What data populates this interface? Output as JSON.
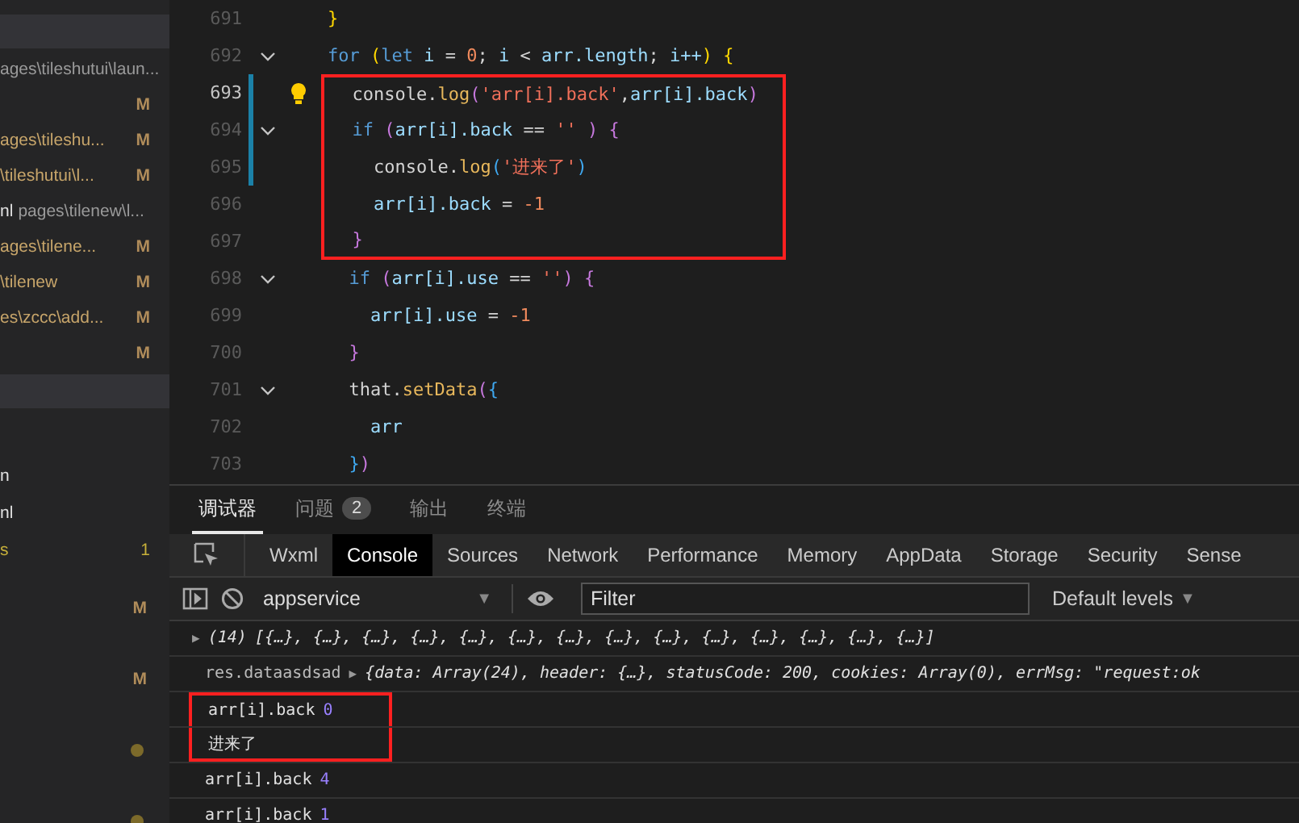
{
  "sidebar": {
    "files": [
      {
        "path": "ages\\tileshutui\\laun..."
      },
      {
        "badge": "M"
      },
      {
        "name": "ages\\tileshu...",
        "badge": "M"
      },
      {
        "name": "\\tileshutui\\l...",
        "badge": "M"
      },
      {
        "name": "nl",
        "path": "pages\\tilenew\\l..."
      },
      {
        "name": "ages\\tilene...",
        "badge": "M"
      },
      {
        "name": "\\tilenew",
        "badge": "M"
      },
      {
        "name": "es\\zccc\\add...",
        "badge": "M"
      },
      {
        "badge": "M"
      }
    ],
    "outline": [
      {
        "name": "n"
      },
      {
        "name": "nl"
      },
      {
        "name": "s",
        "badge": "1"
      }
    ],
    "changes": [
      {
        "kind": "badge",
        "badge": "M"
      },
      {
        "kind": "badge",
        "badge": "M"
      },
      {
        "kind": "dot"
      },
      {
        "kind": "dot"
      }
    ]
  },
  "editor": {
    "lines": [
      {
        "number": "691",
        "fold": false,
        "current": false,
        "modified": false,
        "lightbulb": false,
        "boxed": false,
        "tokens": [
          {
            "kind": "bracket-gold",
            "text": "}"
          }
        ]
      },
      {
        "number": "692",
        "fold": true,
        "current": false,
        "modified": false,
        "lightbulb": false,
        "boxed": false,
        "tokens": [
          {
            "kind": "keyword",
            "text": "for "
          },
          {
            "kind": "bracket-gold",
            "text": "("
          },
          {
            "kind": "keyword",
            "text": "let"
          },
          {
            "kind": "variable",
            "text": " i "
          },
          {
            "kind": "plain",
            "text": "= "
          },
          {
            "kind": "number",
            "text": "0"
          },
          {
            "kind": "plain",
            "text": "; "
          },
          {
            "kind": "variable",
            "text": "i"
          },
          {
            "kind": "plain",
            "text": " < "
          },
          {
            "kind": "variable",
            "text": "arr.length"
          },
          {
            "kind": "plain",
            "text": "; "
          },
          {
            "kind": "variable",
            "text": "i++"
          },
          {
            "kind": "bracket-gold",
            "text": ") {"
          }
        ]
      },
      {
        "number": "693",
        "fold": false,
        "current": true,
        "modified": true,
        "lightbulb": true,
        "boxed": true,
        "tokens": [
          {
            "kind": "plain",
            "text": "  console."
          },
          {
            "kind": "function",
            "text": "log"
          },
          {
            "kind": "bracket-pink",
            "text": "("
          },
          {
            "kind": "string",
            "text": "'arr[i].back'"
          },
          {
            "kind": "plain",
            "text": ","
          },
          {
            "kind": "variable",
            "text": "arr[i].back"
          },
          {
            "kind": "bracket-pink",
            "text": ")"
          }
        ]
      },
      {
        "number": "694",
        "fold": true,
        "current": false,
        "modified": true,
        "lightbulb": false,
        "boxed": true,
        "tokens": [
          {
            "kind": "keyword",
            "text": "  if "
          },
          {
            "kind": "bracket-pink",
            "text": "("
          },
          {
            "kind": "variable",
            "text": "arr[i].back"
          },
          {
            "kind": "plain",
            "text": " == "
          },
          {
            "kind": "string",
            "text": "'' "
          },
          {
            "kind": "bracket-pink",
            "text": ") {"
          }
        ]
      },
      {
        "number": "695",
        "fold": false,
        "current": false,
        "modified": true,
        "lightbulb": false,
        "boxed": true,
        "tokens": [
          {
            "kind": "plain",
            "text": "    console."
          },
          {
            "kind": "function",
            "text": "log"
          },
          {
            "kind": "bracket-blue",
            "text": "("
          },
          {
            "kind": "string",
            "text": "'进来了'"
          },
          {
            "kind": "bracket-blue",
            "text": ")"
          }
        ]
      },
      {
        "number": "696",
        "fold": false,
        "current": false,
        "modified": false,
        "lightbulb": false,
        "boxed": true,
        "tokens": [
          {
            "kind": "variable",
            "text": "    arr[i].back"
          },
          {
            "kind": "plain",
            "text": " = "
          },
          {
            "kind": "number",
            "text": "-1"
          }
        ]
      },
      {
        "number": "697",
        "fold": false,
        "current": false,
        "modified": false,
        "lightbulb": false,
        "boxed": true,
        "tokens": [
          {
            "kind": "bracket-pink",
            "text": "  }"
          }
        ]
      },
      {
        "number": "698",
        "fold": true,
        "current": false,
        "modified": false,
        "lightbulb": false,
        "boxed": false,
        "tokens": [
          {
            "kind": "keyword",
            "text": "  if "
          },
          {
            "kind": "bracket-pink",
            "text": "("
          },
          {
            "kind": "variable",
            "text": "arr[i].use"
          },
          {
            "kind": "plain",
            "text": " == "
          },
          {
            "kind": "string",
            "text": "''"
          },
          {
            "kind": "bracket-pink",
            "text": ") {"
          }
        ]
      },
      {
        "number": "699",
        "fold": false,
        "current": false,
        "modified": false,
        "lightbulb": false,
        "boxed": false,
        "tokens": [
          {
            "kind": "variable",
            "text": "    arr[i].use"
          },
          {
            "kind": "plain",
            "text": " = "
          },
          {
            "kind": "number",
            "text": "-1"
          }
        ]
      },
      {
        "number": "700",
        "fold": false,
        "current": false,
        "modified": false,
        "lightbulb": false,
        "boxed": false,
        "tokens": [
          {
            "kind": "bracket-pink",
            "text": "  }"
          }
        ]
      },
      {
        "number": "701",
        "fold": true,
        "current": false,
        "modified": false,
        "lightbulb": false,
        "boxed": false,
        "tokens": [
          {
            "kind": "plain",
            "text": "  that."
          },
          {
            "kind": "function",
            "text": "setData"
          },
          {
            "kind": "bracket-pink",
            "text": "("
          },
          {
            "kind": "bracket-blue",
            "text": "{"
          }
        ]
      },
      {
        "number": "702",
        "fold": false,
        "current": false,
        "modified": false,
        "lightbulb": false,
        "boxed": false,
        "tokens": [
          {
            "kind": "variable",
            "text": "    arr"
          }
        ]
      },
      {
        "number": "703",
        "fold": false,
        "current": false,
        "modified": false,
        "lightbulb": false,
        "boxed": false,
        "tokens": [
          {
            "kind": "bracket-blue",
            "text": "  }"
          },
          {
            "kind": "bracket-pink",
            "text": ")"
          }
        ]
      }
    ]
  },
  "panel": {
    "tabs": [
      {
        "label": "调试器",
        "selected": true
      },
      {
        "label": "问题",
        "count": "2",
        "selected": false
      },
      {
        "label": "输出",
        "selected": false
      },
      {
        "label": "终端",
        "selected": false
      }
    ],
    "devtools_tabs": [
      {
        "label": "Wxml",
        "selected": false
      },
      {
        "label": "Console",
        "selected": true
      },
      {
        "label": "Sources",
        "selected": false
      },
      {
        "label": "Network",
        "selected": false
      },
      {
        "label": "Performance",
        "selected": false
      },
      {
        "label": "Memory",
        "selected": false
      },
      {
        "label": "AppData",
        "selected": false
      },
      {
        "label": "Storage",
        "selected": false
      },
      {
        "label": "Security",
        "selected": false
      },
      {
        "label": "Sense",
        "selected": false
      }
    ],
    "context": {
      "value": "appservice",
      "caret": "▼"
    },
    "filter": {
      "placeholder": "Filter"
    },
    "levels": {
      "label": "Default levels",
      "caret": "▼"
    },
    "console": [
      {
        "kind": "summary",
        "boxed": false,
        "arrow": "▶",
        "count": "(14)",
        "text": "[{…}, {…}, {…}, {…}, {…}, {…}, {…}, {…}, {…}, {…}, {…}, {…}, {…}, {…}]"
      },
      {
        "kind": "object",
        "boxed": false,
        "label": "res.dataasdsad",
        "arrow": "▶",
        "text": "{data: Array(24), header: {…}, statusCode: 200, cookies: Array(0), errMsg: \"request:ok"
      },
      {
        "kind": "value",
        "boxed": true,
        "label": "arr[i].back",
        "value": "0"
      },
      {
        "kind": "text",
        "boxed": true,
        "text": "进来了"
      },
      {
        "kind": "value",
        "boxed": false,
        "label": "arr[i].back",
        "value": "4"
      },
      {
        "kind": "value",
        "boxed": false,
        "label": "arr[i].back",
        "value": "1"
      }
    ]
  }
}
